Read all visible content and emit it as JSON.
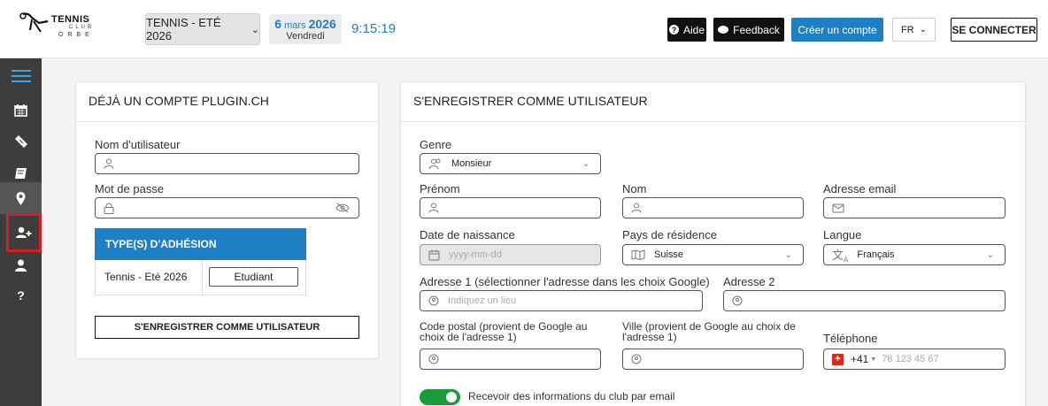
{
  "header": {
    "logo_name": "TENNIS",
    "logo_club": "CLUB",
    "logo_city": "ORBE",
    "season": "TENNIS - ETÉ 2026",
    "date_day": "6",
    "date_month": "mars",
    "date_year": "2026",
    "date_weekday": "Vendredi",
    "time": "9:15:19",
    "help_label": "Aide",
    "feedback_label": "Feedback",
    "create_account_label": "Créer un compte",
    "language": "FR",
    "login_label": "SE CONNECTER"
  },
  "sidebar": {
    "items": [
      {
        "icon": "menu-icon"
      },
      {
        "icon": "calendar-icon"
      },
      {
        "icon": "ticket-icon"
      },
      {
        "icon": "book-icon"
      },
      {
        "icon": "location-pin-icon"
      },
      {
        "icon": "user-add-icon"
      },
      {
        "icon": "user-icon"
      },
      {
        "icon": "help-icon"
      }
    ]
  },
  "login_card": {
    "title": "DÉJÀ UN COMPTE PLUGIN.CH",
    "username_label": "Nom d'utilisateur",
    "password_label": "Mot de passe",
    "membership_header": "TYPE(S) D'ADHÉSION",
    "membership_name": "Tennis - Eté 2026",
    "membership_type": "Etudiant",
    "register_button": "S'ENREGISTRER COMME UTILISATEUR"
  },
  "register_card": {
    "title": "S'ENREGISTRER COMME UTILISATEUR",
    "gender_label": "Genre",
    "gender_value": "Monsieur",
    "firstname_label": "Prénom",
    "lastname_label": "Nom",
    "email_label": "Adresse email",
    "birthdate_label": "Date de naissance",
    "birthdate_placeholder": "yyyy-mm-dd",
    "country_label": "Pays de résidence",
    "country_value": "Suisse",
    "language_label": "Langue",
    "language_value": "Français",
    "address1_label": "Adresse 1 (sélectionner l'adresse dans les choix Google)",
    "address1_placeholder": "Indiquez un lieu",
    "address2_label": "Adresse 2",
    "postal_label_1": "Code postal (provient de Google au",
    "postal_label_2": "choix de l'adresse 1)",
    "city_label_1": "Ville (provient de Google au choix de",
    "city_label_2": "l'adresse 1)",
    "phone_label": "Téléphone",
    "phone_prefix": "+41",
    "phone_placeholder": "78 123 45 67",
    "newsletter_label": "Recevoir des informations du club par email",
    "newsletter_enabled": true
  },
  "colors": {
    "accent": "#1f7fc4",
    "sidebar": "#3d3d3d",
    "toggle_on": "#1a9b3a",
    "highlight": "#d42020"
  }
}
